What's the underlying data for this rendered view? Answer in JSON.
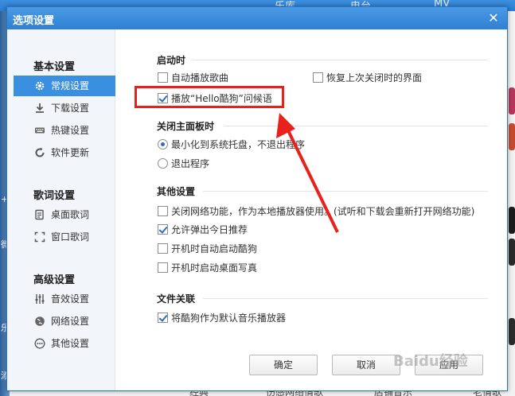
{
  "background": {
    "top_items": [
      "乐库",
      "电台",
      "MV"
    ],
    "bottom_items": [
      "经典",
      "伤感网络情歌",
      "店铺音乐",
      "老情歌"
    ]
  },
  "dialog": {
    "title": "选项设置",
    "close_glyph": "✕"
  },
  "sidebar": {
    "groups": [
      {
        "title": "基本设置",
        "items": [
          {
            "label": "常规设置",
            "icon": "gear-icon"
          },
          {
            "label": "下载设置",
            "icon": "download-icon"
          },
          {
            "label": "热键设置",
            "icon": "keyboard-icon"
          },
          {
            "label": "软件更新",
            "icon": "refresh-icon"
          }
        ]
      },
      {
        "title": "歌词设置",
        "items": [
          {
            "label": "桌面歌词",
            "icon": "desktop-lyrics-icon"
          },
          {
            "label": "窗口歌词",
            "icon": "window-lyrics-icon"
          }
        ]
      },
      {
        "title": "高级设置",
        "items": [
          {
            "label": "音效设置",
            "icon": "equalizer-icon"
          },
          {
            "label": "网络设置",
            "icon": "globe-icon"
          },
          {
            "label": "其他设置",
            "icon": "more-icon"
          }
        ]
      }
    ]
  },
  "sections": {
    "startup": {
      "title": "启动时",
      "auto_play": {
        "label": "自动播放歌曲",
        "checked": false
      },
      "restore_ui": {
        "label": "恢复上次关闭时的界面",
        "checked": false
      },
      "greeting": {
        "label": "播放“Hello酷狗”问候语",
        "checked": true
      }
    },
    "close_panel": {
      "title": "关闭主面板时",
      "minimize": {
        "label": "最小化到系统托盘，不退出程序",
        "selected": true
      },
      "exit": {
        "label": "退出程序",
        "selected": false
      }
    },
    "other": {
      "title": "其他设置",
      "disable_network": {
        "label": "关闭网络功能，作为本地播放器使用。(试听和下载会重新打开网络功能)",
        "checked": false
      },
      "daily_popup": {
        "label": "允许弹出今日推荐",
        "checked": true
      },
      "autostart": {
        "label": "开机时自动启动酷狗",
        "checked": false
      },
      "desktop_photo": {
        "label": "开机时启动桌面写真",
        "checked": false
      }
    },
    "file_assoc": {
      "title": "文件关联",
      "default_player": {
        "label": "将酷狗作为默认音乐播放器",
        "checked": true
      }
    }
  },
  "footer": {
    "ok": "确定",
    "cancel": "取消",
    "apply": "应用"
  },
  "watermark": "Baidu经验",
  "colors": {
    "accent": "#3b8fe0",
    "annotation": "#e8211c"
  }
}
